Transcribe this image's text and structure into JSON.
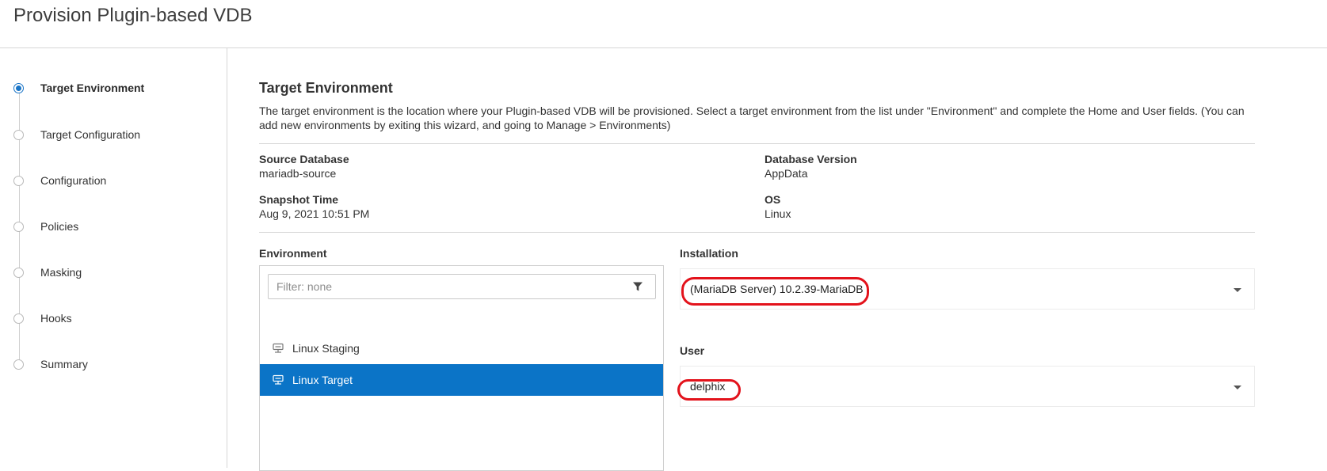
{
  "page": {
    "title": "Provision Plugin-based VDB"
  },
  "wizard": {
    "steps": [
      {
        "label": "Target Environment",
        "active": true
      },
      {
        "label": "Target Configuration",
        "active": false
      },
      {
        "label": "Configuration",
        "active": false
      },
      {
        "label": "Policies",
        "active": false
      },
      {
        "label": "Masking",
        "active": false
      },
      {
        "label": "Hooks",
        "active": false
      },
      {
        "label": "Summary",
        "active": false
      }
    ]
  },
  "section": {
    "heading": "Target Environment",
    "description": "The target environment is the location where your Plugin-based VDB will be provisioned. Select a target environment from the list under \"Environment\" and complete the Home and User fields. (You can add new environments by exiting this wizard, and going to Manage > Environments)"
  },
  "source_info": {
    "source_database": {
      "label": "Source Database",
      "value": "mariadb-source"
    },
    "database_version": {
      "label": "Database Version",
      "value": "AppData"
    },
    "snapshot_time": {
      "label": "Snapshot Time",
      "value": "Aug 9, 2021 10:51 PM"
    },
    "os": {
      "label": "OS",
      "value": "Linux"
    }
  },
  "environment": {
    "label": "Environment",
    "filter_placeholder": "Filter: none",
    "filter_value": "",
    "items": [
      {
        "label": "Linux Staging",
        "selected": false,
        "icon": "server-icon"
      },
      {
        "label": "Linux Target",
        "selected": true,
        "icon": "server-icon"
      }
    ]
  },
  "installation": {
    "label": "Installation",
    "value": "(MariaDB Server) 10.2.39-MariaDB"
  },
  "user": {
    "label": "User",
    "value": "delphix"
  },
  "colors": {
    "accent": "#0b74c7",
    "annotation": "#e3121b"
  }
}
